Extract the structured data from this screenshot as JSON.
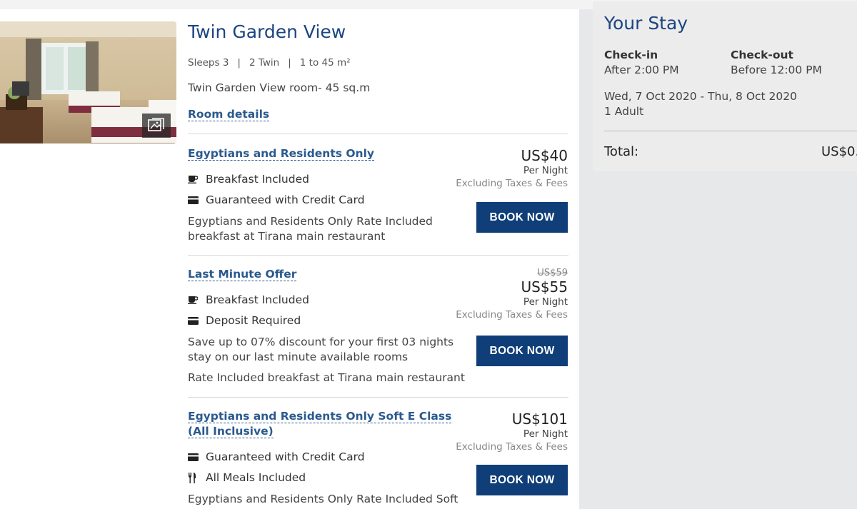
{
  "room": {
    "title": "Twin Garden View",
    "sleeps": "Sleeps 3",
    "beds": "2 Twin",
    "size": "1 to 45 m²",
    "description": "Twin Garden View room- 45 sq.m",
    "details_link": "Room details"
  },
  "rates": [
    {
      "name": "Egyptians and Residents Only",
      "features": [
        {
          "icon": "coffee-cup-icon",
          "label": "Breakfast Included"
        },
        {
          "icon": "credit-card-icon",
          "label": "Guaranteed with Credit Card"
        }
      ],
      "description": [
        "Egyptians and Residents Only Rate Included breakfast at Tirana main restaurant"
      ],
      "old_price": "",
      "price": "US$40",
      "per": "Per Night",
      "tax": "Excluding Taxes & Fees",
      "button": "BOOK NOW"
    },
    {
      "name": "Last Minute Offer",
      "features": [
        {
          "icon": "coffee-cup-icon",
          "label": "Breakfast Included"
        },
        {
          "icon": "credit-card-icon",
          "label": "Deposit Required"
        }
      ],
      "description": [
        "Save up to 07% discount for your first 03 nights stay on our last minute available rooms",
        "Rate Included breakfast at Tirana main restaurant"
      ],
      "old_price": "US$59",
      "price": "US$55",
      "per": "Per Night",
      "tax": "Excluding Taxes & Fees",
      "button": "BOOK NOW"
    },
    {
      "name": "Egyptians and Residents Only Soft E Class (All Inclusive)",
      "features": [
        {
          "icon": "credit-card-icon",
          "label": "Guaranteed with Credit Card"
        },
        {
          "icon": "fork-knife-icon",
          "label": "All Meals Included"
        }
      ],
      "description": [
        "Egyptians and Residents Only Rate Included Soft"
      ],
      "old_price": "",
      "price": "US$101",
      "per": "Per Night",
      "tax": "Excluding Taxes & Fees",
      "button": "BOOK NOW"
    }
  ],
  "stay": {
    "title": "Your Stay",
    "checkin_label": "Check-in",
    "checkin_value": "After 2:00 PM",
    "checkout_label": "Check-out",
    "checkout_value": "Before 12:00 PM",
    "dates": "Wed, 7 Oct 2020 - Thu, 8 Oct 2020",
    "guests": "1 Adult",
    "total_label": "Total:",
    "total_value": "US$0."
  },
  "colors": {
    "accent": "#1c4480",
    "button": "#0f3e78",
    "link": "#2a5a8e"
  }
}
